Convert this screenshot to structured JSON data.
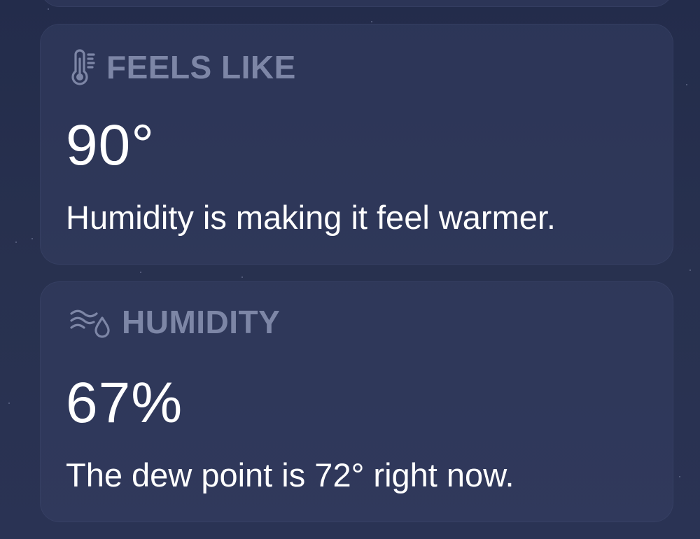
{
  "feels_like": {
    "icon": "thermometer-icon",
    "label": "FEELS LIKE",
    "value": "90°",
    "description": "Humidity is making it feel warmer."
  },
  "humidity": {
    "icon": "humidity-icon",
    "label": "HUMIDITY",
    "value": "67%",
    "description": "The dew point is 72° right now."
  },
  "colors": {
    "background": "#262f4f",
    "card": "#343e62",
    "label": "#7d86a6",
    "value": "#ffffff"
  }
}
